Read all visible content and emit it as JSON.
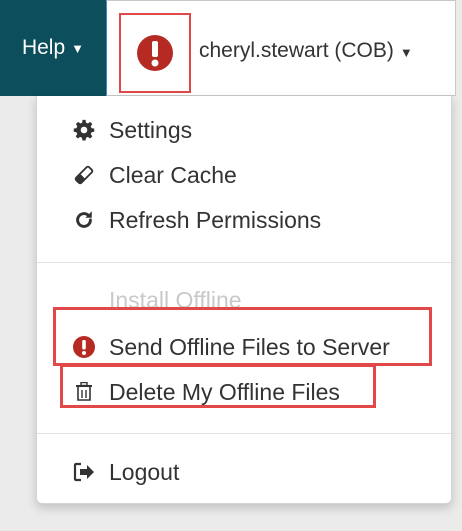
{
  "navbar": {
    "help_label": "Help",
    "user_label": "cheryl.stewart (COB)",
    "user_alert_icon": "exclamation-circle-icon"
  },
  "menu": {
    "settings": {
      "label": "Settings",
      "icon": "gear-icon"
    },
    "clear_cache": {
      "label": "Clear Cache",
      "icon": "eraser-icon"
    },
    "refresh_permissions": {
      "label": "Refresh Permissions",
      "icon": "refresh-icon"
    },
    "install_offline": {
      "label": "Install Offline"
    },
    "send_offline_files": {
      "label": "Send Offline Files to Server",
      "icon": "exclamation-circle-icon"
    },
    "delete_offline_files": {
      "label": "Delete My Offline Files",
      "icon": "trash-icon"
    },
    "logout": {
      "label": "Logout",
      "icon": "sign-out-icon"
    }
  },
  "colors": {
    "help_tab_bg": "#0c4e5b",
    "alert_red": "#b52a22",
    "highlight_red": "#e24848",
    "menu_text": "#333333",
    "disabled_text": "#c9c9c9"
  }
}
